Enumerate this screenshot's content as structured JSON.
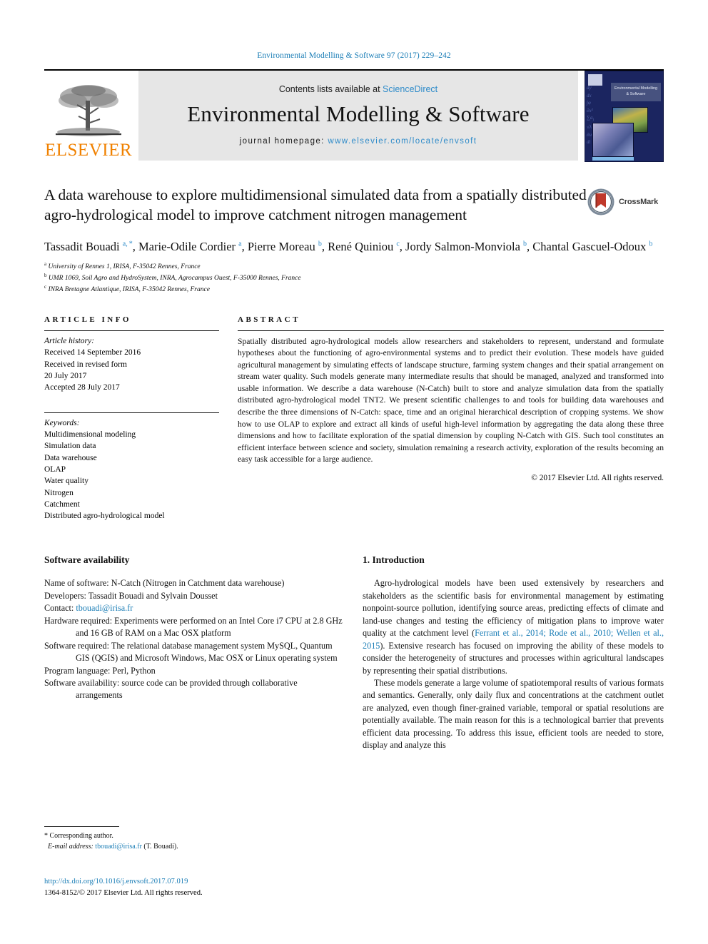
{
  "running_head": "Environmental Modelling & Software 97 (2017) 229–242",
  "masthead": {
    "publisher_name": "ELSEVIER",
    "contents_prefix": "Contents lists available at ",
    "contents_link": "ScienceDirect",
    "journal_title": "Environmental Modelling & Software",
    "homepage_prefix": "journal homepage: ",
    "homepage_url": "www.elsevier.com/locate/envsoft",
    "cover_title": "Environmental Modelling & Software"
  },
  "title": "A data warehouse to explore multidimensional simulated data from a spatially distributed agro-hydrological model to improve catchment nitrogen management",
  "crossmark_label": "CrossMark",
  "authors_html": "Tassadit Bouadi <sup>a, *</sup>, Marie-Odile Cordier <sup>a</sup>, Pierre Moreau <sup>b</sup>, René Quiniou <sup>c</sup>, Jordy Salmon-Monviola <sup>b</sup>, Chantal Gascuel-Odoux <sup>b</sup>",
  "affiliations": [
    {
      "sup": "a",
      "text": "University of Rennes 1, IRISA, F-35042 Rennes, France"
    },
    {
      "sup": "b",
      "text": "UMR 1069, Soil Agro and HydroSystem, INRA, Agrocampus Ouest, F-35000 Rennes, France"
    },
    {
      "sup": "c",
      "text": "INRA Bretagne Atlantique, IRISA, F-35042 Rennes, France"
    }
  ],
  "article_info": {
    "label": "ARTICLE INFO",
    "history_header": "Article history:",
    "history_lines": [
      "Received 14 September 2016",
      "Received in revised form",
      "20 July 2017",
      "Accepted 28 July 2017"
    ],
    "keywords_header": "Keywords:",
    "keywords": [
      "Multidimensional modeling",
      "Simulation data",
      "Data warehouse",
      "OLAP",
      "Water quality",
      "Nitrogen",
      "Catchment",
      "Distributed agro-hydrological model"
    ]
  },
  "abstract": {
    "label": "ABSTRACT",
    "text": "Spatially distributed agro-hydrological models allow researchers and stakeholders to represent, understand and formulate hypotheses about the functioning of agro-environmental systems and to predict their evolution. These models have guided agricultural management by simulating effects of landscape structure, farming system changes and their spatial arrangement on stream water quality. Such models generate many intermediate results that should be managed, analyzed and transformed into usable information. We describe a data warehouse (N-Catch) built to store and analyze simulation data from the spatially distributed agro-hydrological model TNT2. We present scientific challenges to and tools for building data warehouses and describe the three dimensions of N-Catch: space, time and an original hierarchical description of cropping systems. We show how to use OLAP to explore and extract all kinds of useful high-level information by aggregating the data along these three dimensions and how to facilitate exploration of the spatial dimension by coupling N-Catch with GIS. Such tool constitutes an efficient interface between science and society, simulation remaining a research activity, exploration of the results becoming an easy task accessible for a large audience.",
    "copyright": "© 2017 Elsevier Ltd. All rights reserved."
  },
  "software_availability": {
    "heading": "Software availability",
    "items": [
      {
        "label": "Name of software:",
        "value": " N-Catch (Nitrogen in Catchment data warehouse)"
      },
      {
        "label": "Developers:",
        "value": " Tassadit Bouadi and Sylvain Dousset"
      },
      {
        "label": "Contact:",
        "value": " tbouadi@irisa.fr",
        "is_link": true
      },
      {
        "label": "Hardware required:",
        "value": " Experiments were performed on an Intel Core i7 CPU at 2.8 GHz and 16 GB of RAM on a Mac OSX platform"
      },
      {
        "label": "Software required:",
        "value": " The relational database management system MySQL, Quantum GIS (QGIS) and Microsoft Windows, Mac OSX or Linux operating system"
      },
      {
        "label": "Program language:",
        "value": " Perl, Python"
      },
      {
        "label": "Software availability:",
        "value": " source code can be provided through collaborative arrangements"
      }
    ]
  },
  "introduction": {
    "heading": "1. Introduction",
    "paragraphs": [
      {
        "segments": [
          {
            "t": "Agro-hydrological models have been used extensively by researchers and stakeholders as the scientific basis for environmental management by estimating nonpoint-source pollution, identifying source areas, predicting effects of climate and land-use changes and testing the efficiency of mitigation plans to improve water quality at the catchment level ("
          },
          {
            "t": "Ferrant et al., 2014; Rode et al., 2010; Wellen et al., 2015",
            "link": true
          },
          {
            "t": "). Extensive research has focused on improving the ability of these models to consider the heterogeneity of structures and processes within agricultural landscapes by representing their spatial distributions."
          }
        ]
      },
      {
        "segments": [
          {
            "t": "These models generate a large volume of spatiotemporal results of various formats and semantics. Generally, only daily flux and concentrations at the catchment outlet are analyzed, even though finer-grained variable, temporal or spatial resolutions are potentially available. The main reason for this is a technological barrier that prevents efficient data processing. To address this issue, efficient tools are needed to store, display and analyze this"
          }
        ]
      }
    ]
  },
  "footnote": {
    "corresponding": "* Corresponding author.",
    "email_label": "E-mail address:",
    "email": " tbouadi@irisa.fr",
    "email_suffix": " (T. Bouadi)."
  },
  "doi_block": {
    "doi": "http://dx.doi.org/10.1016/j.envsoft.2017.07.019",
    "issn_line": "1364-8152/© 2017 Elsevier Ltd. All rights reserved."
  },
  "colors": {
    "link_blue": "#1a7db6",
    "accent_blue": "#2e8bc9",
    "elsevier_orange": "#f08100",
    "masthead_gray": "#e6e6e6"
  }
}
